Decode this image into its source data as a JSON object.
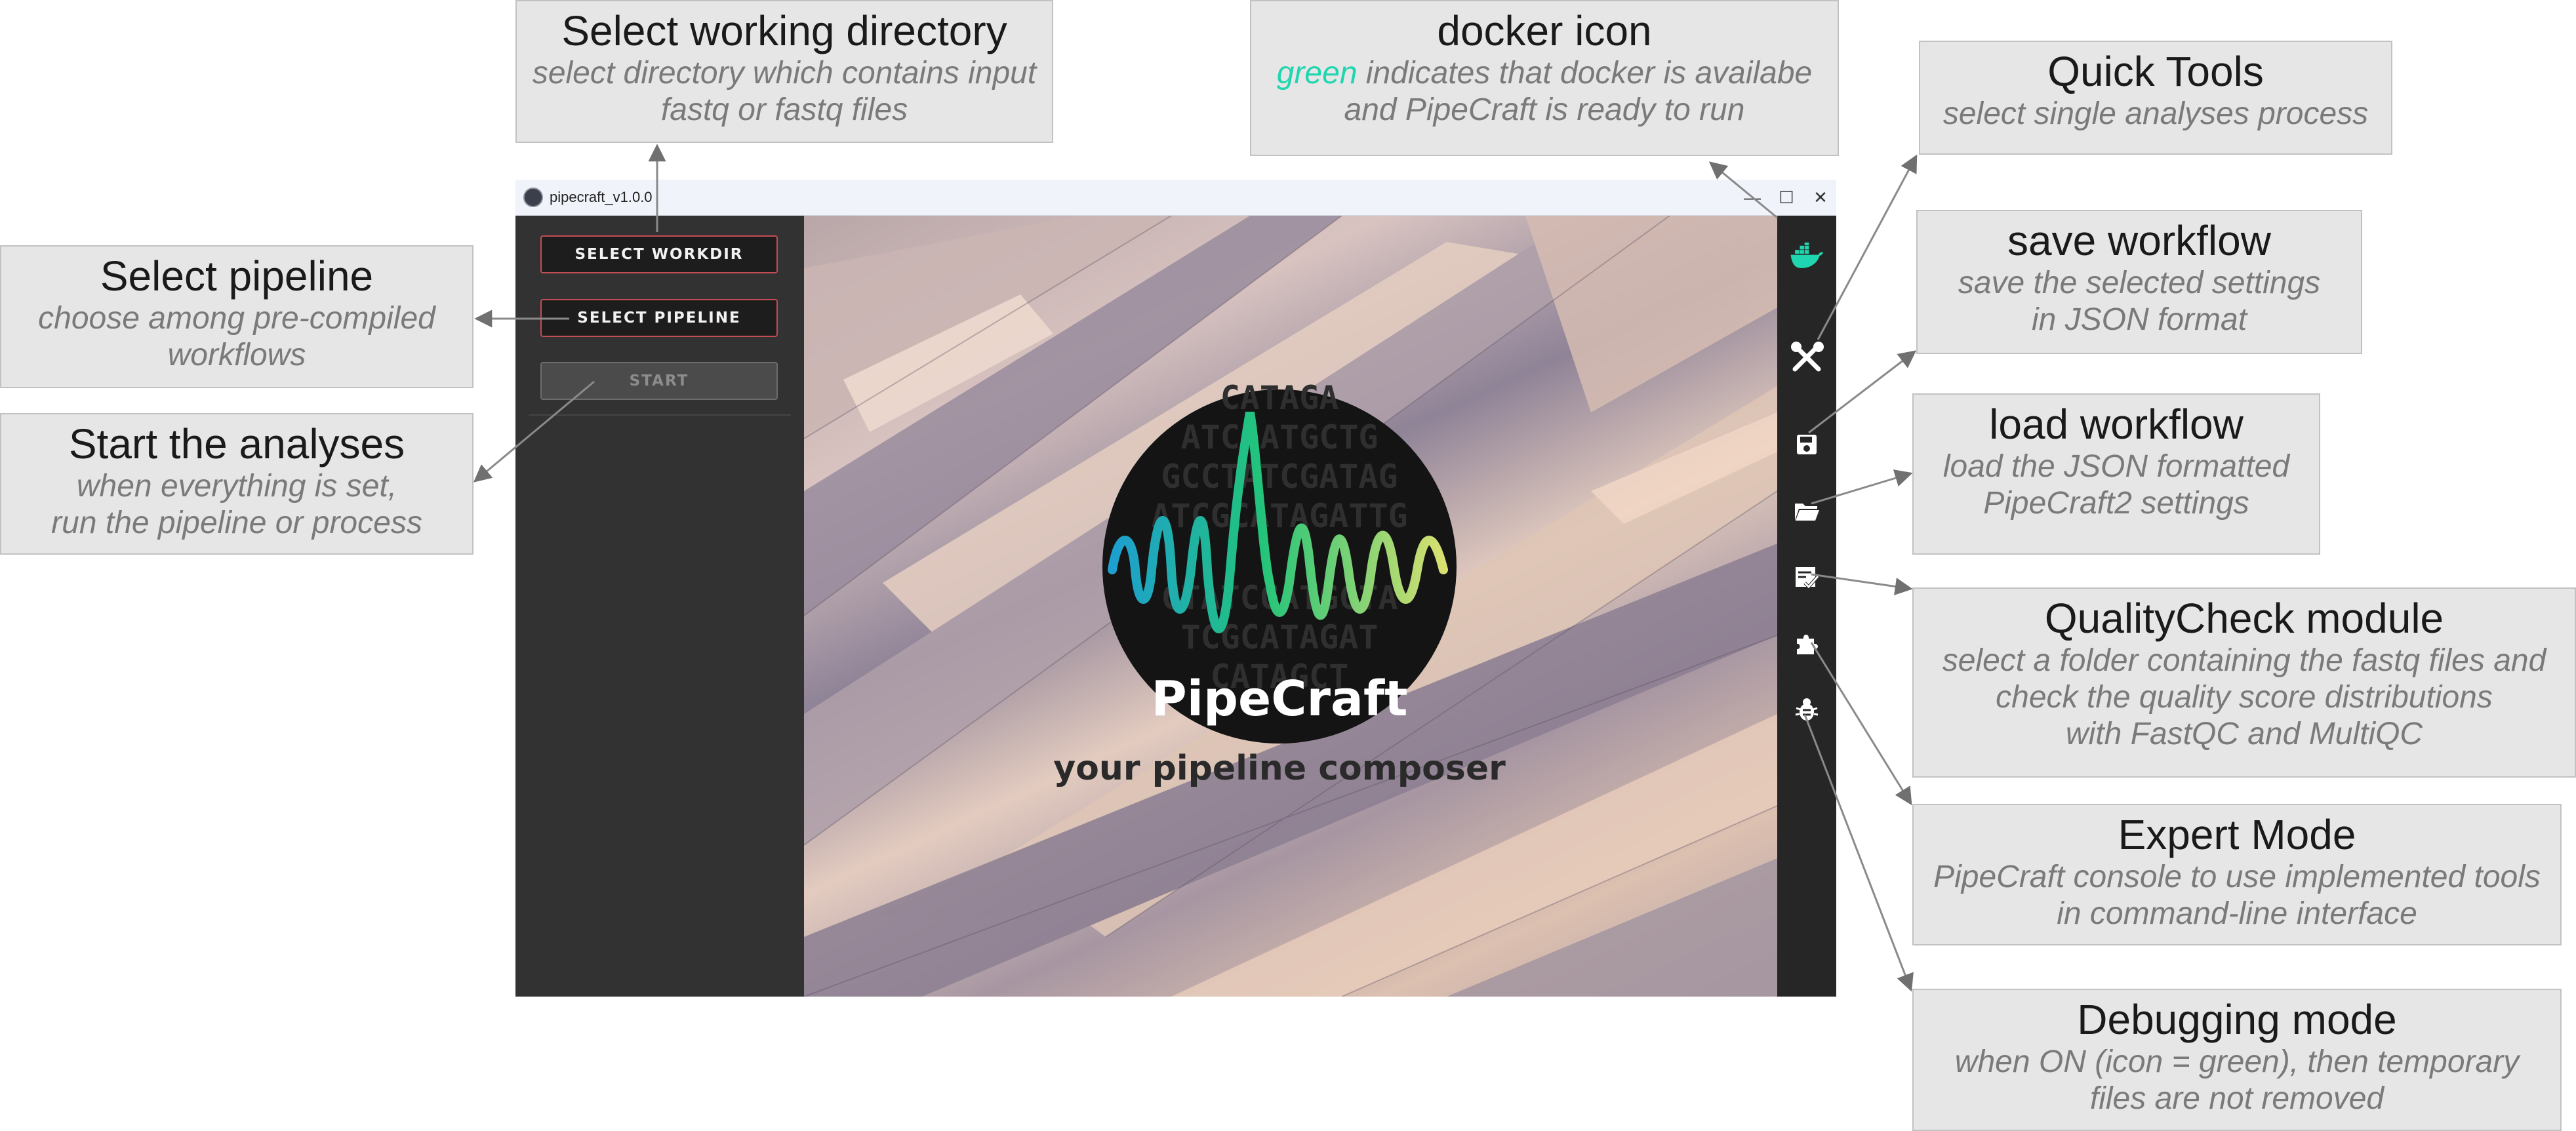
{
  "window": {
    "title": "pipecraft_v1.0.0",
    "controls": {
      "minimize": "—",
      "maximize": "☐",
      "close": "✕"
    }
  },
  "left_panel": {
    "buttons": [
      {
        "label": "SELECT WORKDIR",
        "state": "enabled"
      },
      {
        "label": "SELECT PIPELINE",
        "state": "enabled"
      },
      {
        "label": "START",
        "state": "disabled"
      }
    ]
  },
  "main": {
    "logo": {
      "name": "PipeCraft",
      "tagline": "your pipeline composer",
      "dna_rows": [
        "CATAGA",
        "ATCGATGCTG",
        "GCCTATCGATAG",
        "ATCGCATAGATTG",
        "CTATCGATGCTA",
        "TCGCATAGAT",
        "CATAGCT"
      ]
    }
  },
  "right_bar": {
    "icons": [
      {
        "name": "docker-icon",
        "color": "#1fd6b0"
      },
      {
        "name": "quick-tools-icon",
        "color": "#ffffff"
      },
      {
        "name": "save-workflow-icon",
        "color": "#ffffff"
      },
      {
        "name": "load-workflow-icon",
        "color": "#ffffff"
      },
      {
        "name": "quality-check-icon",
        "color": "#ffffff"
      },
      {
        "name": "expert-mode-icon",
        "color": "#ffffff"
      },
      {
        "name": "debug-mode-icon",
        "color": "#ffffff"
      }
    ]
  },
  "annotations": {
    "select_workdir": {
      "title": "Select working directory",
      "desc1": "select directory which contains input",
      "desc2": "fastq or fastq files"
    },
    "docker": {
      "title": "docker icon",
      "green_word": "green",
      "desc1_rest": " indicates that docker is availabe",
      "desc2": "and PipeCraft is ready to run"
    },
    "quick_tools": {
      "title": "Quick Tools",
      "desc1": "select single analyses process"
    },
    "select_pipeline": {
      "title": "Select pipeline",
      "desc1": "choose among pre-compiled",
      "desc2": "workflows"
    },
    "save_workflow": {
      "title": "save workflow",
      "desc1": "save the selected settings",
      "desc2": "in JSON format"
    },
    "start": {
      "title": "Start the analyses",
      "desc1": "when everything is set,",
      "desc2": "run the pipeline or process"
    },
    "load_workflow": {
      "title": "load workflow",
      "desc1": "load the JSON formatted",
      "desc2": "PipeCraft2 settings"
    },
    "quality_check": {
      "title": "QualityCheck module",
      "desc1": "select a folder containing the fastq files and",
      "desc2": "check the quality score distributions",
      "desc3": "with FastQC and MultiQC"
    },
    "expert_mode": {
      "title": "Expert Mode",
      "desc1": "PipeCraft console to use implemented tools",
      "desc2": "in command-line interface"
    },
    "debugging": {
      "title": "Debugging mode",
      "desc1": "when ON (icon = green), then temporary",
      "desc2": "files are not removed"
    }
  },
  "colors": {
    "docker_green": "#1fd6b0",
    "button_border": "#c34d52",
    "panel_bg": "#323232",
    "rightbar_bg": "#262626",
    "annotation_bg": "#e6e6e6"
  }
}
